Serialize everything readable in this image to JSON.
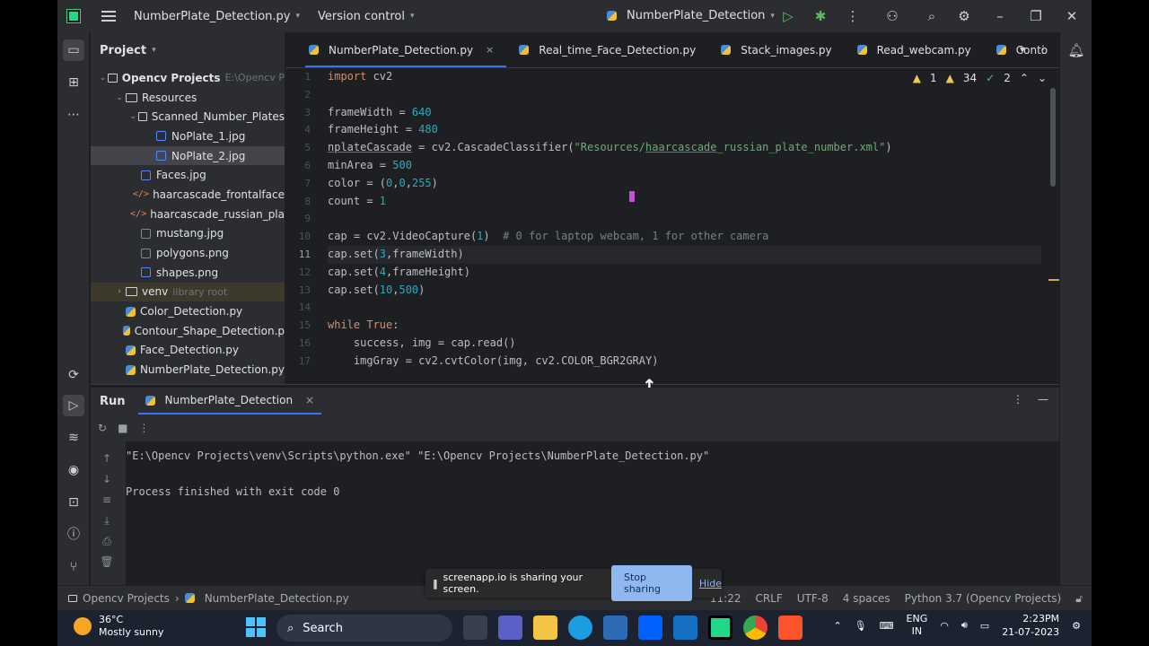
{
  "titlebar": {
    "project": "NumberPlate_Detection.py",
    "vcs": "Version control",
    "run_config": "NumberPlate_Detection"
  },
  "project_panel": {
    "title": "Project",
    "items": [
      {
        "label": "Opencv Projects",
        "hint": "E:\\Opencv P",
        "type": "folder",
        "level": 0
      },
      {
        "label": "Resources",
        "type": "folder",
        "level": 1
      },
      {
        "label": "Scanned_Number_Plates",
        "type": "folder",
        "level": 2
      },
      {
        "label": "NoPlate_1.jpg",
        "type": "image",
        "level": 3
      },
      {
        "label": "NoPlate_2.jpg",
        "type": "image",
        "level": 3,
        "selected": true
      },
      {
        "label": "Faces.jpg",
        "type": "image",
        "level": 2
      },
      {
        "label": "haarcascade_frontalface",
        "type": "xml",
        "level": 2
      },
      {
        "label": "haarcascade_russian_pla",
        "type": "xml",
        "level": 2
      },
      {
        "label": "mustang.jpg",
        "type": "image",
        "level": 2
      },
      {
        "label": "polygons.png",
        "type": "image",
        "level": 2
      },
      {
        "label": "shapes.png",
        "type": "image",
        "level": 2
      },
      {
        "label": "venv",
        "hint": "library root",
        "type": "folder",
        "level": 1,
        "excluded": true
      },
      {
        "label": "Color_Detection.py",
        "type": "py",
        "level": 1
      },
      {
        "label": "Contour_Shape_Detection.p",
        "type": "py",
        "level": 1
      },
      {
        "label": "Face_Detection.py",
        "type": "py",
        "level": 1
      },
      {
        "label": "NumberPlate_Detection.py",
        "type": "py",
        "level": 1
      }
    ]
  },
  "editor": {
    "tabs": [
      {
        "label": "NumberPlate_Detection.py",
        "active": true
      },
      {
        "label": "Real_time_Face_Detection.py"
      },
      {
        "label": "Stack_images.py"
      },
      {
        "label": "Read_webcam.py"
      },
      {
        "label": "Conto"
      }
    ],
    "inspections": {
      "warnings": "1",
      "weak": "34",
      "ok": "2"
    },
    "line_numbers": [
      "1",
      "2",
      "3",
      "4",
      "5",
      "6",
      "7",
      "8",
      "9",
      "10",
      "11",
      "12",
      "13",
      "14",
      "15",
      "16",
      "17"
    ],
    "current_line": "11"
  },
  "run_panel": {
    "title": "Run",
    "tab": "NumberPlate_Detection",
    "output": [
      "\"E:\\Opencv Projects\\venv\\Scripts\\python.exe\" \"E:\\Opencv Projects\\NumberPlate_Detection.py\"",
      "",
      "Process finished with exit code 0"
    ]
  },
  "status_bar": {
    "breadcrumb_root": "Opencv Projects",
    "breadcrumb_file": "NumberPlate_Detection.py",
    "position": "11:22",
    "line_ending": "CRLF",
    "encoding": "UTF-8",
    "indent": "4 spaces",
    "interpreter": "Python 3.7 (Opencv Projects)"
  },
  "share_bar": {
    "message": "screenapp.io is sharing your screen.",
    "stop": "Stop sharing",
    "hide": "Hide"
  },
  "taskbar": {
    "temperature": "36°C",
    "weather": "Mostly sunny",
    "search": "Search",
    "lang1": "ENG",
    "lang2": "IN",
    "time": "2:23PM",
    "date": "21-07-2023"
  },
  "colors": {
    "accent": "#3574f0",
    "keyword": "#cf8e6d",
    "number": "#2aacb8",
    "string": "#6aab73"
  }
}
